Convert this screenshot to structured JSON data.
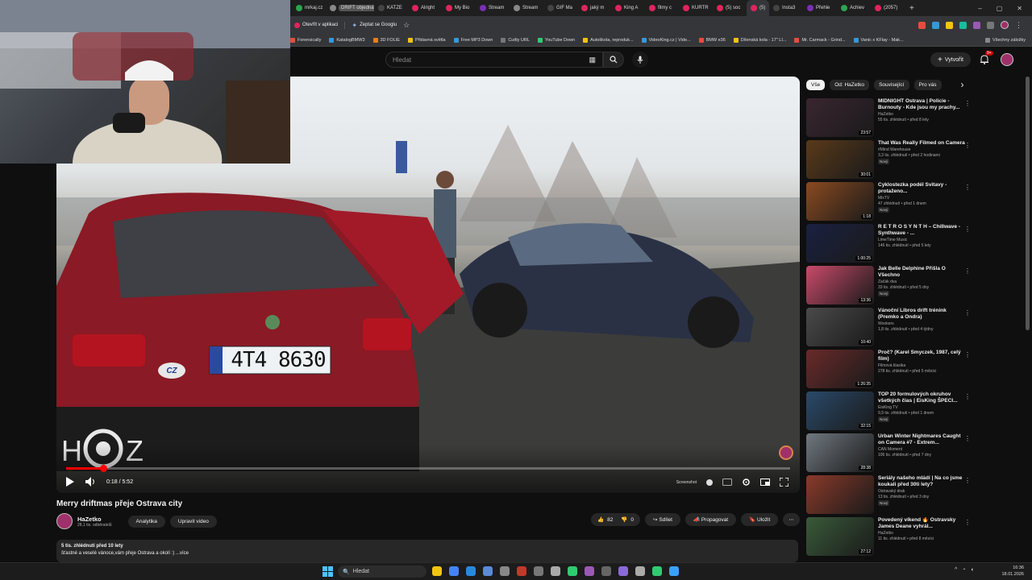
{
  "browser": {
    "tabs": [
      {
        "label": "mrkaj.cz",
        "color": "#2ea44f"
      },
      {
        "label": "DRIFT objednávky",
        "color": "#888888"
      },
      {
        "label": "KATZE",
        "color": "#444444"
      },
      {
        "label": "Alright",
        "color": "#e0245e"
      },
      {
        "label": "My Bio",
        "color": "#e0245e"
      },
      {
        "label": "Stream",
        "color": "#7b2fb5"
      },
      {
        "label": "Stream",
        "color": "#888888"
      },
      {
        "label": "GIF Ma",
        "color": "#444444"
      },
      {
        "label": "jaký m",
        "color": "#e0245e"
      },
      {
        "label": "King A",
        "color": "#e0245e"
      },
      {
        "label": "filmy c",
        "color": "#e0245e"
      },
      {
        "label": "KURTR",
        "color": "#e0245e"
      },
      {
        "label": "(5) soc",
        "color": "#e0245e"
      },
      {
        "label": "(5)",
        "color": "#e0245e",
        "active": true
      },
      {
        "label": "Insta3",
        "color": "#444444"
      },
      {
        "label": "Přehle",
        "color": "#7b2fb5"
      },
      {
        "label": "Achiev",
        "color": "#2ea44f"
      },
      {
        "label": "(2057)",
        "color": "#e0245e"
      }
    ],
    "open_in_app": "Otevřít v aplikaci",
    "ask_google": "Zeptat se Googlu",
    "bookmarks": [
      {
        "label": "Forensically",
        "color": "#e74c3c"
      },
      {
        "label": "KatalogBMW3",
        "color": "#3498db"
      },
      {
        "label": "3D FOLIE",
        "color": "#e67e22"
      },
      {
        "label": "Přidavná světla",
        "color": "#f1c40f"
      },
      {
        "label": "Free MP3 Down",
        "color": "#3498db"
      },
      {
        "label": "Cuttly URL",
        "color": "#777777"
      },
      {
        "label": "YouTube Down",
        "color": "#2ecc71"
      },
      {
        "label": "Autoškola, reproduk...",
        "color": "#f1c40f"
      },
      {
        "label": "VideoKing.cz | Vide...",
        "color": "#3498db"
      },
      {
        "label": "BMW e36",
        "color": "#e74c3c"
      },
      {
        "label": "Dílenská kola - 17\" LI...",
        "color": "#f1c40f"
      },
      {
        "label": "Mr. Carmack - Grind...",
        "color": "#e74c3c"
      },
      {
        "label": "Vanic x KFlay - Mak...",
        "color": "#3498db"
      }
    ],
    "all_bookmarks": "Všechny záložky"
  },
  "youtube": {
    "search_placeholder": "Hledat",
    "create_label": "Vytvořit",
    "notifications": "9+"
  },
  "player": {
    "time": "0:18 / 5:52",
    "progress": 0.051,
    "plate": "4T4 8630",
    "plate_country": "CZ",
    "watermark": "Screenshot"
  },
  "video": {
    "title": "Merry driftmas přeje Ostrava city",
    "channel": "HaZetko",
    "subscribers": "28,1 tis. odběratelů",
    "analytics": "Analytika",
    "edit": "Upravit video",
    "likes": "82",
    "dislikes": "0",
    "share": "Sdílet",
    "promote": "Propagovat",
    "save": "Uložit",
    "views_date": "5 tis. zhlédnutí  před 10 lety",
    "description": "šťastné a veselé vánoce,vám přeje Ostrava a okolí :) ...více"
  },
  "sidebar": {
    "chips": [
      "Vše",
      "Od: HaZetko",
      "Související",
      "Pro vás"
    ],
    "recommendations": [
      {
        "title": "MIDNIGHT Ostrava | Policie - Burnouty - Kde jsou my prachy...",
        "channel": "HaZetko",
        "meta": "55 tis. zhlédnutí • před 8 lety",
        "duration": "23:57",
        "new": "",
        "thumb": "#3a2630"
      },
      {
        "title": "That Was Really Filmed on Camera",
        "channel": "#Mind Warehouse",
        "meta": "3,3 tis. zhlédnutí • před 2 hodinami",
        "duration": "30:01",
        "new": "Nový",
        "thumb": "#5a3a1a"
      },
      {
        "title": "Cyklostezka podél Svitavy - protaženo...",
        "channel": "MixTV",
        "meta": "47 zhlédnutí • před 1 dnem",
        "duration": "1:18",
        "new": "Nový",
        "thumb": "#8a4a20"
      },
      {
        "title": "R E T R O S Y N T H – Chillwave - Synthwave - ...",
        "channel": "LimeTime Music",
        "meta": "146 tis. zhlédnutí • před 5 lety",
        "duration": "1:00:25",
        "new": "",
        "thumb": "#1a2040"
      },
      {
        "title": "Jak Belle Delphine Přišla O Všechno",
        "channel": "Začák dva",
        "meta": "33 tis. zhlédnutí • před 5 dny",
        "duration": "13:36",
        "new": "Nový",
        "thumb": "#c94a6a"
      },
      {
        "title": "Vánoční Libros drift trénink (Premko a Ondra)",
        "channel": "Wookers",
        "meta": "1,8 tis. zhlédnutí • před 4 týdny",
        "duration": "10:40",
        "new": "",
        "thumb": "#4a4a4a"
      },
      {
        "title": "Proč? (Karel Smyczek, 1987, celý film)",
        "channel": "Filmová klasika",
        "meta": "278 tis. zhlédnutí • před 5 měsíci",
        "duration": "1:26:35",
        "new": "",
        "thumb": "#6a2a2a"
      },
      {
        "title": "TOP 20 formulových okruhov všetkých čias | EisKing ŠPECI...",
        "channel": "EisKing TV",
        "meta": "9,9 tis. zhlédnutí • před 1 dnem",
        "duration": "32:15",
        "new": "Nový",
        "thumb": "#2a4a6a"
      },
      {
        "title": "Urban Winter Nightmares Caught on Camera #7 - Extrem...",
        "channel": "CAN Moment",
        "meta": "106 tis. zhlédnutí • před 7 dny",
        "duration": "28:38",
        "new": "",
        "thumb": "#707880"
      },
      {
        "title": "Seriály našeho mládí | Na co jsme koukali před 30ti lety?",
        "channel": "Ostravský drak",
        "meta": "13 tis. zhlédnutí • před 3 dny",
        "duration": "",
        "new": "Nový",
        "thumb": "#8a3a2a"
      },
      {
        "title": "Povedený víkend 🔥 Ostravsky James Deane vyhrál...",
        "channel": "HaZetko",
        "meta": "11 tis. zhlédnutí • před 8 měsíci",
        "duration": "27:12",
        "new": "",
        "thumb": "#3a5a3a"
      }
    ]
  },
  "taskbar": {
    "search": "Hledat",
    "time": "16:36",
    "date": "18.01.2026"
  }
}
